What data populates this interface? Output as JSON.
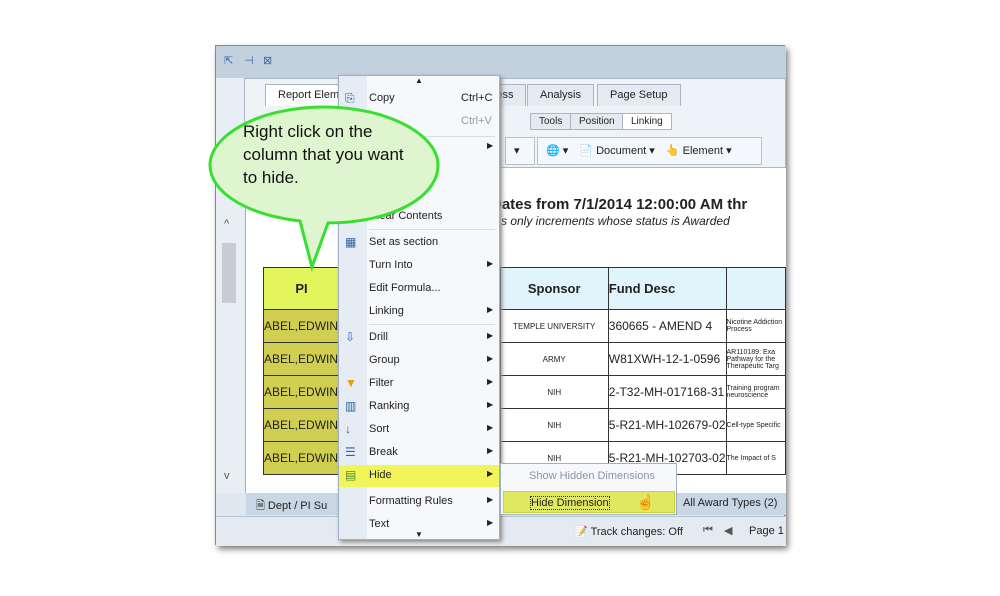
{
  "window": {
    "buttons": [
      "restore",
      "pin",
      "close"
    ]
  },
  "ribbon": {
    "tabs": [
      "Report Elements",
      "Access",
      "Analysis",
      "Page Setup"
    ],
    "subtabs": [
      "Tools",
      "Position",
      "Linking"
    ],
    "tools": {
      "hyperlink": "",
      "document": "Document",
      "element": "Element"
    }
  },
  "report": {
    "title": "Dates from 7/1/2014 12:00:00 AM thr",
    "subtitle": "s only increments whose status is Awarded",
    "headers": {
      "pi": "PI",
      "sponsor": "Sponsor",
      "fund": "Fund Desc"
    },
    "rows": [
      {
        "pi": "ABEL,EDWIN",
        "sponsor": "TEMPLE UNIVERSITY",
        "fund": "360665 - AMEND 4",
        "desc": "Nicotine Addiction Process"
      },
      {
        "pi": "ABEL,EDWIN",
        "sponsor": "ARMY",
        "fund": "W81XWH-12-1-0596",
        "desc": "AR110189: Exa Pathway for the Therapeutic Targ"
      },
      {
        "pi": "ABEL,EDWIN",
        "sponsor": "NIH",
        "fund": "2-T32-MH-017168-31",
        "desc": "Training program neuroscience"
      },
      {
        "pi": "ABEL,EDWIN",
        "sponsor": "NIH",
        "fund": "5-R21-MH-102679-02",
        "desc": "Cell-type Specific"
      },
      {
        "pi": "ABEL,EDWIN",
        "sponsor": "NIH",
        "fund": "5-R21-MH-102703-02",
        "desc": "The Impact of S"
      }
    ]
  },
  "bottom_tabs": [
    "Dept / PI Su",
    "All Award Types (2)"
  ],
  "status": {
    "track": "Track changes: Off",
    "page": "Page 1"
  },
  "menu": {
    "items": [
      {
        "label": "Copy",
        "shortcut": "Ctrl+C"
      },
      {
        "label": "",
        "shortcut": "Ctrl+V"
      },
      {
        "label": "Clear Contents"
      },
      {
        "label": "Set as section"
      },
      {
        "label": "Turn Into"
      },
      {
        "label": "Edit Formula..."
      },
      {
        "label": "Linking"
      },
      {
        "label": "Drill"
      },
      {
        "label": "Group"
      },
      {
        "label": "Filter"
      },
      {
        "label": "Ranking"
      },
      {
        "label": "Sort"
      },
      {
        "label": "Break"
      },
      {
        "label": "Hide"
      },
      {
        "label": "Formatting Rules"
      },
      {
        "label": "Text"
      }
    ]
  },
  "submenu": {
    "show": "Show Hidden Dimensions",
    "hide": "Hide Dimension"
  },
  "callout": {
    "text": "Right click on the column that you want to hide."
  },
  "colors": {
    "callout_fill": "#dff5cf",
    "callout_border": "#37e02f",
    "highlight": "#f2f55a",
    "pi_header": "#e2f55c",
    "pi_cell": "#d0cf52"
  }
}
